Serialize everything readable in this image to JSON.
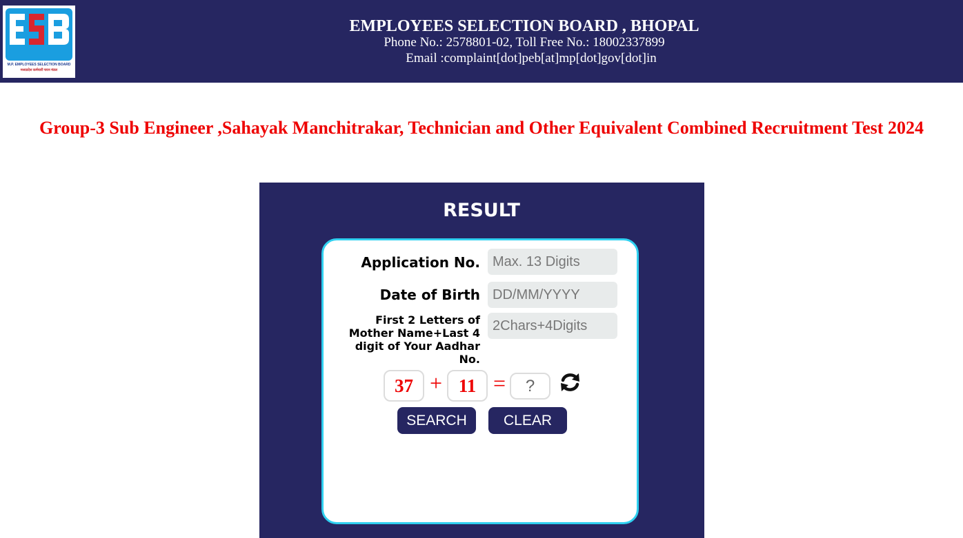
{
  "header": {
    "logo_subtitle_en": "M.P. EMPLOYEES SELECTION BOARD",
    "logo_subtitle_hi": "मध्यप्रदेश कर्मचारी चयन मंडल",
    "org_name": "EMPLOYEES SELECTION BOARD , BHOPAL",
    "phone_line": "Phone No.: 2578801-02, Toll Free No.: 18002337899",
    "email_line": "Email :complaint[dot]peb[at]mp[dot]gov[dot]in"
  },
  "exam_title": "Group-3 Sub Engineer ,Sahayak Manchitrakar, Technician and Other Equivalent Combined Recruitment Test 2024",
  "result_panel": {
    "title": "RESULT",
    "form": {
      "application_label": "Application No.",
      "application_placeholder": "Max. 13 Digits",
      "dob_label": "Date of Birth",
      "dob_placeholder": "DD/MM/YYYY",
      "mother_aadhar_label": "First 2 Letters of Mother Name+Last 4 digit of Your Aadhar No.",
      "mother_aadhar_placeholder": "2Chars+4Digits"
    },
    "captcha": {
      "operand1": "37",
      "operator": "+",
      "operand2": "11",
      "equals": "=",
      "answer_placeholder": "?",
      "refresh_icon": "refresh-icon"
    },
    "buttons": {
      "search": "SEARCH",
      "clear": "CLEAR"
    }
  },
  "colors": {
    "header_bg": "#262661",
    "title_red": "#ee0000",
    "card_border": "#2fd0f0",
    "logo_blue": "#1a9ee0",
    "logo_red": "#d9262e"
  }
}
